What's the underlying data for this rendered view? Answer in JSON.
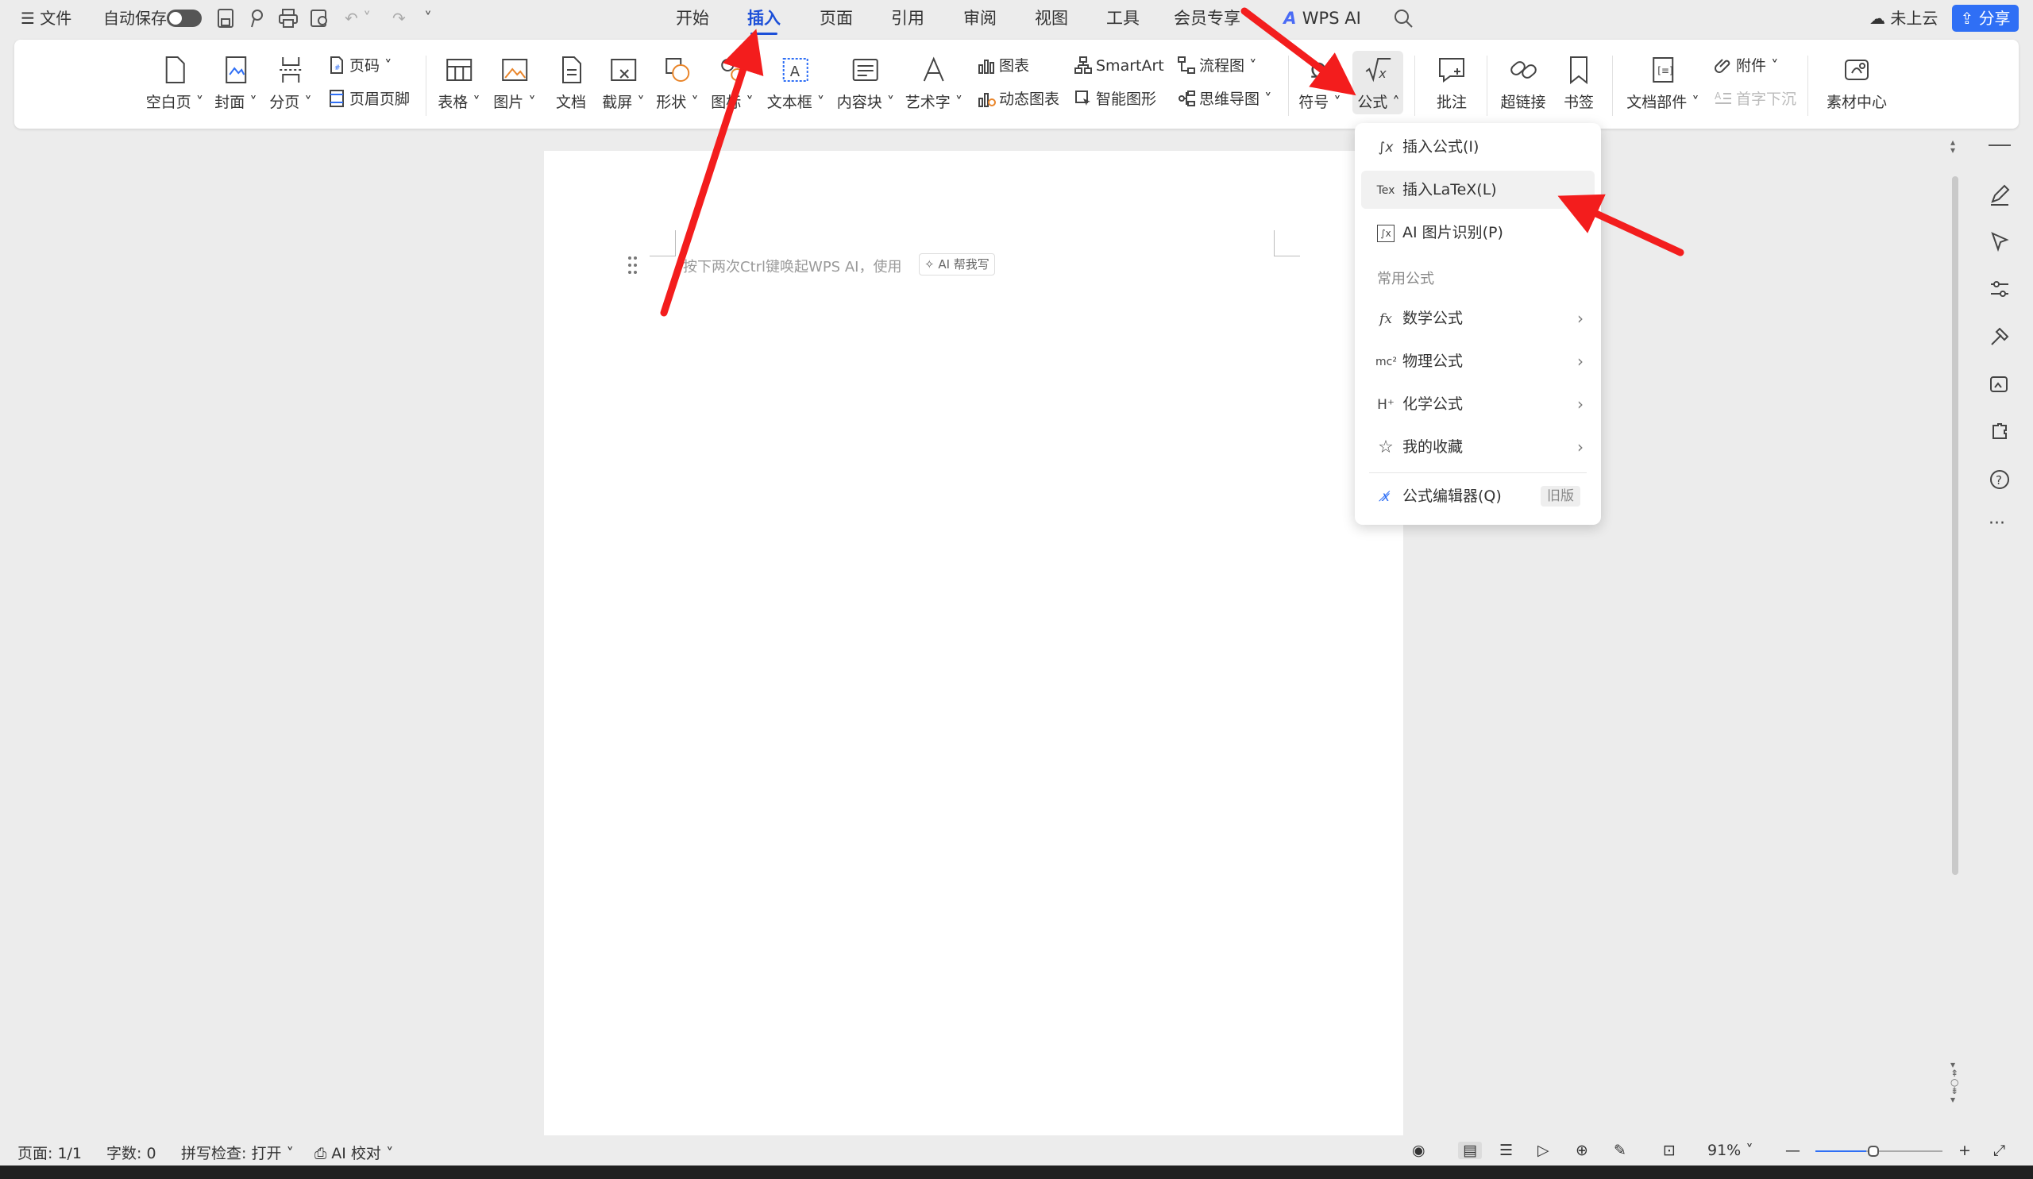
{
  "topbar": {
    "menu_label": "文件",
    "autosave_label": "自动保存",
    "tabs": [
      "开始",
      "插入",
      "页面",
      "引用",
      "审阅",
      "视图",
      "工具",
      "会员专享",
      "WPS AI"
    ],
    "active_tab": "插入",
    "cloud_label": "未上云",
    "share_label": "分享"
  },
  "ribbon": {
    "blank_page": "空白页",
    "cover": "封面",
    "page_break": "分页",
    "page_number": "页码",
    "header_footer": "页眉页脚",
    "table": "表格",
    "picture": "图片",
    "document": "文档",
    "screenshot": "截屏",
    "shape": "形状",
    "icon": "图标",
    "textbox": "文本框",
    "content_block": "内容块",
    "wordart": "艺术字",
    "chart": "图表",
    "dynamic_chart": "动态图表",
    "smartart": "SmartArt",
    "smart_shape": "智能图形",
    "flowchart": "流程图",
    "mindmap": "思维导图",
    "symbol": "符号",
    "formula": "公式",
    "comment": "批注",
    "hyperlink": "超链接",
    "bookmark": "书签",
    "doc_parts": "文档部件",
    "attachment": "附件",
    "drop_cap": "首字下沉",
    "material_center": "素材中心"
  },
  "document": {
    "hint": "按下两次Ctrl键唤起WPS AI，使用",
    "ai_chip": "AI 帮我写"
  },
  "dropdown": {
    "insert_formula": "插入公式(I)",
    "insert_latex": "插入LaTeX(L)",
    "ai_image_recognition": "AI 图片识别(P)",
    "common_header": "常用公式",
    "math": "数学公式",
    "physics": "物理公式",
    "chemistry": "化学公式",
    "favorites": "我的收藏",
    "editor": "公式编辑器(Q)",
    "old_badge": "旧版"
  },
  "statusbar": {
    "page": "页面: 1/1",
    "words": "字数: 0",
    "spellcheck": "拼写检查: 打开",
    "ai_proofread": "AI 校对",
    "zoom": "91%"
  },
  "colors": {
    "accent": "#1c4fd8",
    "share_button": "#2f6ff5",
    "arrow": "#f31d1d"
  },
  "icons": [
    "menu-icon",
    "toggle-icon",
    "save-icon",
    "undo-icon",
    "redo-icon",
    "search-icon",
    "cloud-icon",
    "share-icon",
    "formula-icon",
    "latex-icon",
    "fx-icon",
    "star-icon",
    "pen-icon",
    "cursor-icon",
    "settings-icon",
    "help-icon",
    "more-icon",
    "eye-icon",
    "zoom-out-icon",
    "zoom-in-icon"
  ]
}
